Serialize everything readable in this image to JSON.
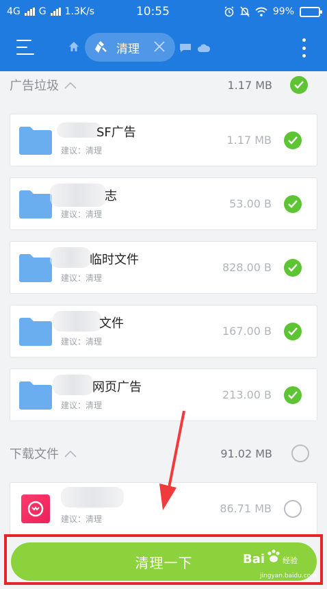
{
  "status_bar": {
    "network_1": "4G",
    "network_2": "G",
    "speed": "1.3K/s",
    "time": "10:55",
    "battery": "99%"
  },
  "toolbar": {
    "active_tab_label": "清理"
  },
  "sections": [
    {
      "title": "广告垃圾",
      "size": "1.17 MB",
      "checked": true,
      "items": [
        {
          "name": "SF广告",
          "hint": "建议：清理",
          "size": "1.17 MB",
          "checked": true
        },
        {
          "name": "志",
          "hint": "建议：清理",
          "size": "53.00 B",
          "checked": true
        },
        {
          "name": "临时文件",
          "hint": "建议：清理",
          "size": "828.00 B",
          "checked": true
        },
        {
          "name": "文件",
          "hint": "建议：清理",
          "size": "167.00 B",
          "checked": true
        },
        {
          "name": "网页广告",
          "hint": "建议：清理",
          "size": "213.00 B",
          "checked": true
        }
      ]
    },
    {
      "title": "下载文件",
      "size": "91.02 MB",
      "checked": false,
      "items": [
        {
          "name": "",
          "hint": "建议：清理",
          "size": "86.71 MB",
          "checked": false
        }
      ]
    }
  ],
  "clean_button_label": "清理一下",
  "watermark": {
    "brand": "Bai",
    "brand_end": "经验",
    "url": "jingyan.baidu.com"
  },
  "colors": {
    "primary": "#1f7be0",
    "check_green": "#5dc434",
    "button_green": "#8bd23c",
    "highlight_red": "#e5252a",
    "folder_blue": "#6aaef0"
  }
}
